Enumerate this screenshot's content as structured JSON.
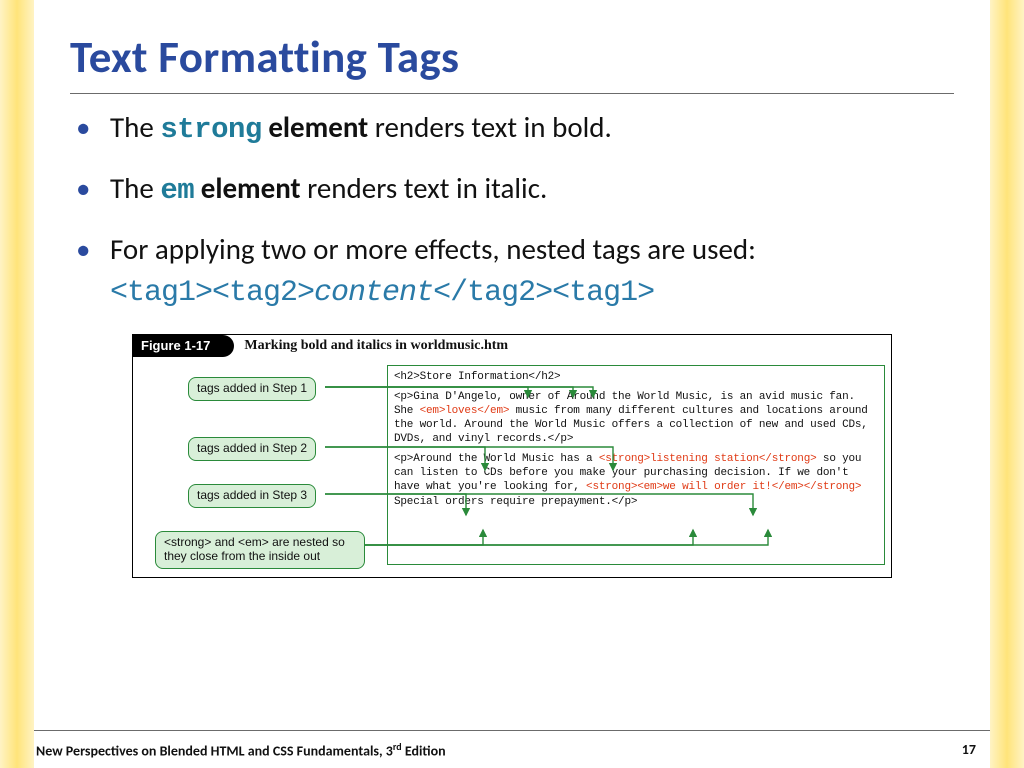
{
  "title": "Text Formatting Tags",
  "bullets": {
    "b1": {
      "pre": "The ",
      "code": "strong",
      "mid": " element",
      "post": " renders text in bold."
    },
    "b2": {
      "pre": "The ",
      "code": "em",
      "mid": " element",
      "post": " renders text in italic."
    },
    "b3": {
      "text": "For applying two or more effects, nested tags are used:",
      "codeline": {
        "t1": "<tag1><tag2>",
        "content": "content",
        "t2": "</tag2><tag1>"
      }
    }
  },
  "figure": {
    "label": "Figure 1-17",
    "caption": "Marking bold and italics in worldmusic.htm",
    "annot": {
      "a1": "tags added in Step 1",
      "a2": "tags added in Step 2",
      "a3": "tags added in Step 3",
      "a4": "<strong> and <em> are nested so they close from the inside out"
    },
    "code": {
      "l1": "<h2>Store Information</h2>",
      "l2a": "<p>Gina D'Angelo, owner of Around the World Music, is an avid music fan. She ",
      "em1": "<em>",
      "loves": "loves",
      "em2": "</em>",
      "l2b": " music from many different cultures and locations around the world. Around the World Music offers a collection of new and used CDs, DVDs, and vinyl records.</p>",
      "l3a": "<p>Around the World Music has a ",
      "s1": "<strong>",
      "ls": "listening station",
      "s1c": "</strong>",
      "l3b": " so you can listen to CDs before you make your purchasing decision. If we don't have what you're looking for, ",
      "s2": "<strong><em>",
      "order": "we will order it!",
      "s2c": "</em></strong>",
      "l3c": " Special orders require prepayment.</p>"
    }
  },
  "footer": {
    "book": "New Perspectives on Blended HTML and CSS Fundamentals, 3",
    "ed": "rd",
    "edition": " Edition",
    "page": "17"
  }
}
